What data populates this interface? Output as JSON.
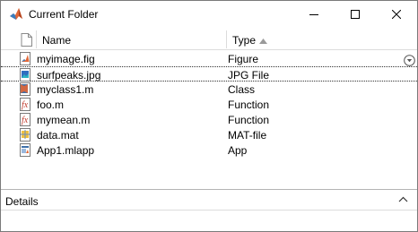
{
  "window": {
    "title": "Current Folder"
  },
  "columns": {
    "name": "Name",
    "type": "Type"
  },
  "files": [
    {
      "name": "myimage.fig",
      "type": "Figure",
      "icon": "fig-file-icon"
    },
    {
      "name": "surfpeaks.jpg",
      "type": "JPG File",
      "icon": "image-file-icon"
    },
    {
      "name": "myclass1.m",
      "type": "Class",
      "icon": "class-file-icon"
    },
    {
      "name": "foo.m",
      "type": "Function",
      "icon": "function-file-icon"
    },
    {
      "name": "mymean.m",
      "type": "Function",
      "icon": "function-file-icon"
    },
    {
      "name": "data.mat",
      "type": "MAT-file",
      "icon": "mat-file-icon"
    },
    {
      "name": "App1.mlapp",
      "type": "App",
      "icon": "app-file-icon"
    }
  ],
  "details": {
    "label": "Details"
  },
  "sort": {
    "column": "Type",
    "direction": "ascending"
  },
  "colors": {
    "matlab_orange": "#e16737",
    "function_red": "#c0392b"
  }
}
